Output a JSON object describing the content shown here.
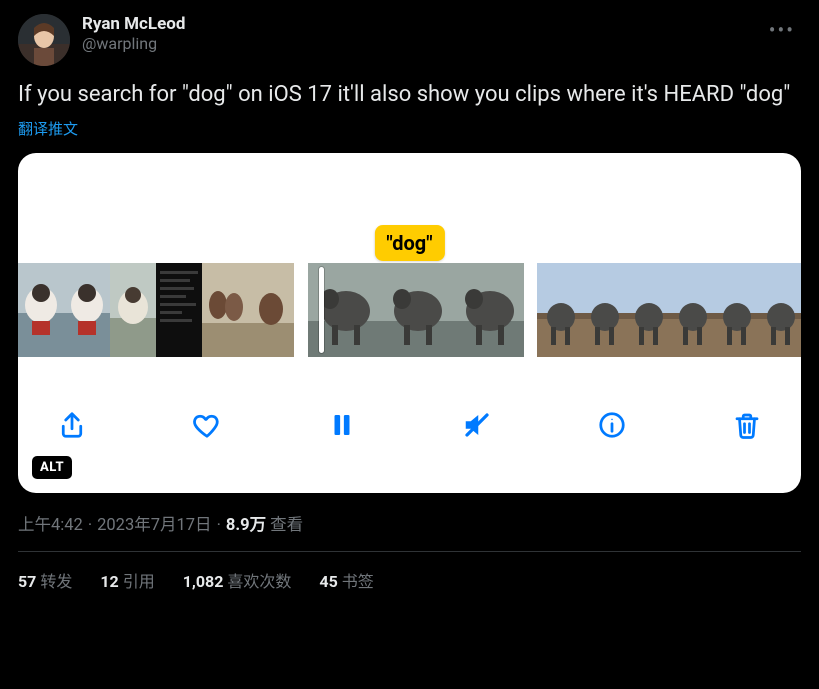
{
  "author": {
    "display_name": "Ryan McLeod",
    "handle": "@warpling"
  },
  "tweet_text": "If you search for \"dog\" on iOS 17 it'll also show you clips where it's HEARD \"dog\"",
  "translate_label": "翻译推文",
  "media": {
    "bubble_text": "\"dog\"",
    "alt_badge": "ALT",
    "toolbar": {
      "share": "share",
      "like": "like",
      "pause": "pause",
      "mute": "mute",
      "info": "info",
      "trash": "trash"
    }
  },
  "meta": {
    "time": "上午4:42",
    "date": "2023年7月17日",
    "views_number": "8.9万",
    "views_label": "查看"
  },
  "stats": {
    "retweets_num": "57",
    "retweets_label": "转发",
    "quotes_num": "12",
    "quotes_label": "引用",
    "likes_num": "1,082",
    "likes_label": "喜欢次数",
    "bookmarks_num": "45",
    "bookmarks_label": "书签"
  }
}
